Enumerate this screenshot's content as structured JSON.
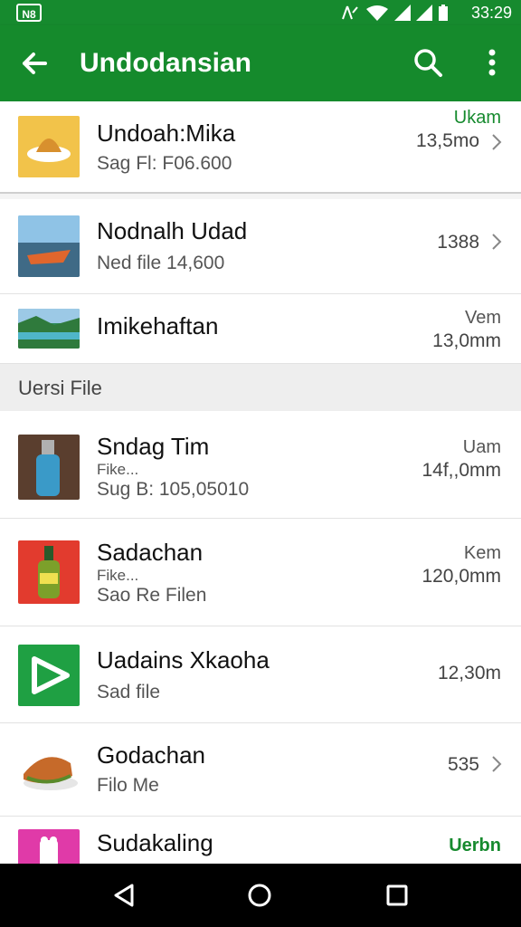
{
  "status_bar": {
    "time": "33:29",
    "left_badge": "N8",
    "icons": [
      "signal-icon",
      "wifi-icon",
      "cell-icon",
      "cell-icon",
      "battery-icon"
    ]
  },
  "toolbar": {
    "title": "Undodansian",
    "back_icon": "arrow-back-icon",
    "search_icon": "search-icon",
    "more_icon": "more-vert-icon"
  },
  "items_top": [
    {
      "name": "Undoah:Mika",
      "sub": "Sag Fl: F06.600",
      "meta_top": "Ukam",
      "meta_bottom": "13,5mo",
      "chevron": true
    },
    {
      "name": "Nodnalh Udad",
      "sub": "Ned file 14,600",
      "meta_top": "",
      "meta_bottom": "1388",
      "chevron": true
    },
    {
      "name": "Imikehaftan",
      "sub": "",
      "meta_top": "Vem",
      "meta_bottom": "13,0mm",
      "chevron": false
    }
  ],
  "section_header": "Uersi File",
  "items_bottom": [
    {
      "name": "Sndag Tim",
      "sub1": "Fike...",
      "sub2": "Sug B: 105,05010",
      "meta_top": "Uam",
      "meta_bottom": "14f,,0mm"
    },
    {
      "name": "Sadachan",
      "sub1": "Fike...",
      "sub2": "Sao Re Filen",
      "meta_top": "Kem",
      "meta_bottom": "120,0mm"
    },
    {
      "name": "Uadains Xkaoha",
      "sub1": "",
      "sub2": "Sad file",
      "meta_top": "",
      "meta_bottom": "12,30m"
    },
    {
      "name": "Godachan",
      "sub1": "",
      "sub2": "Filo Me",
      "meta_top": "",
      "meta_bottom": "535",
      "chevron": true
    },
    {
      "name": "Sudakaling",
      "sub1": "",
      "sub2": "",
      "meta_top": "Uerbn",
      "meta_bottom": ""
    }
  ],
  "colors": {
    "primary": "#158a2c",
    "accent_text": "#168a2e",
    "section_bg": "#eeeeee"
  },
  "nav": {
    "back_icon": "nav-back-icon",
    "home_icon": "nav-home-icon",
    "recents_icon": "nav-recents-icon"
  }
}
